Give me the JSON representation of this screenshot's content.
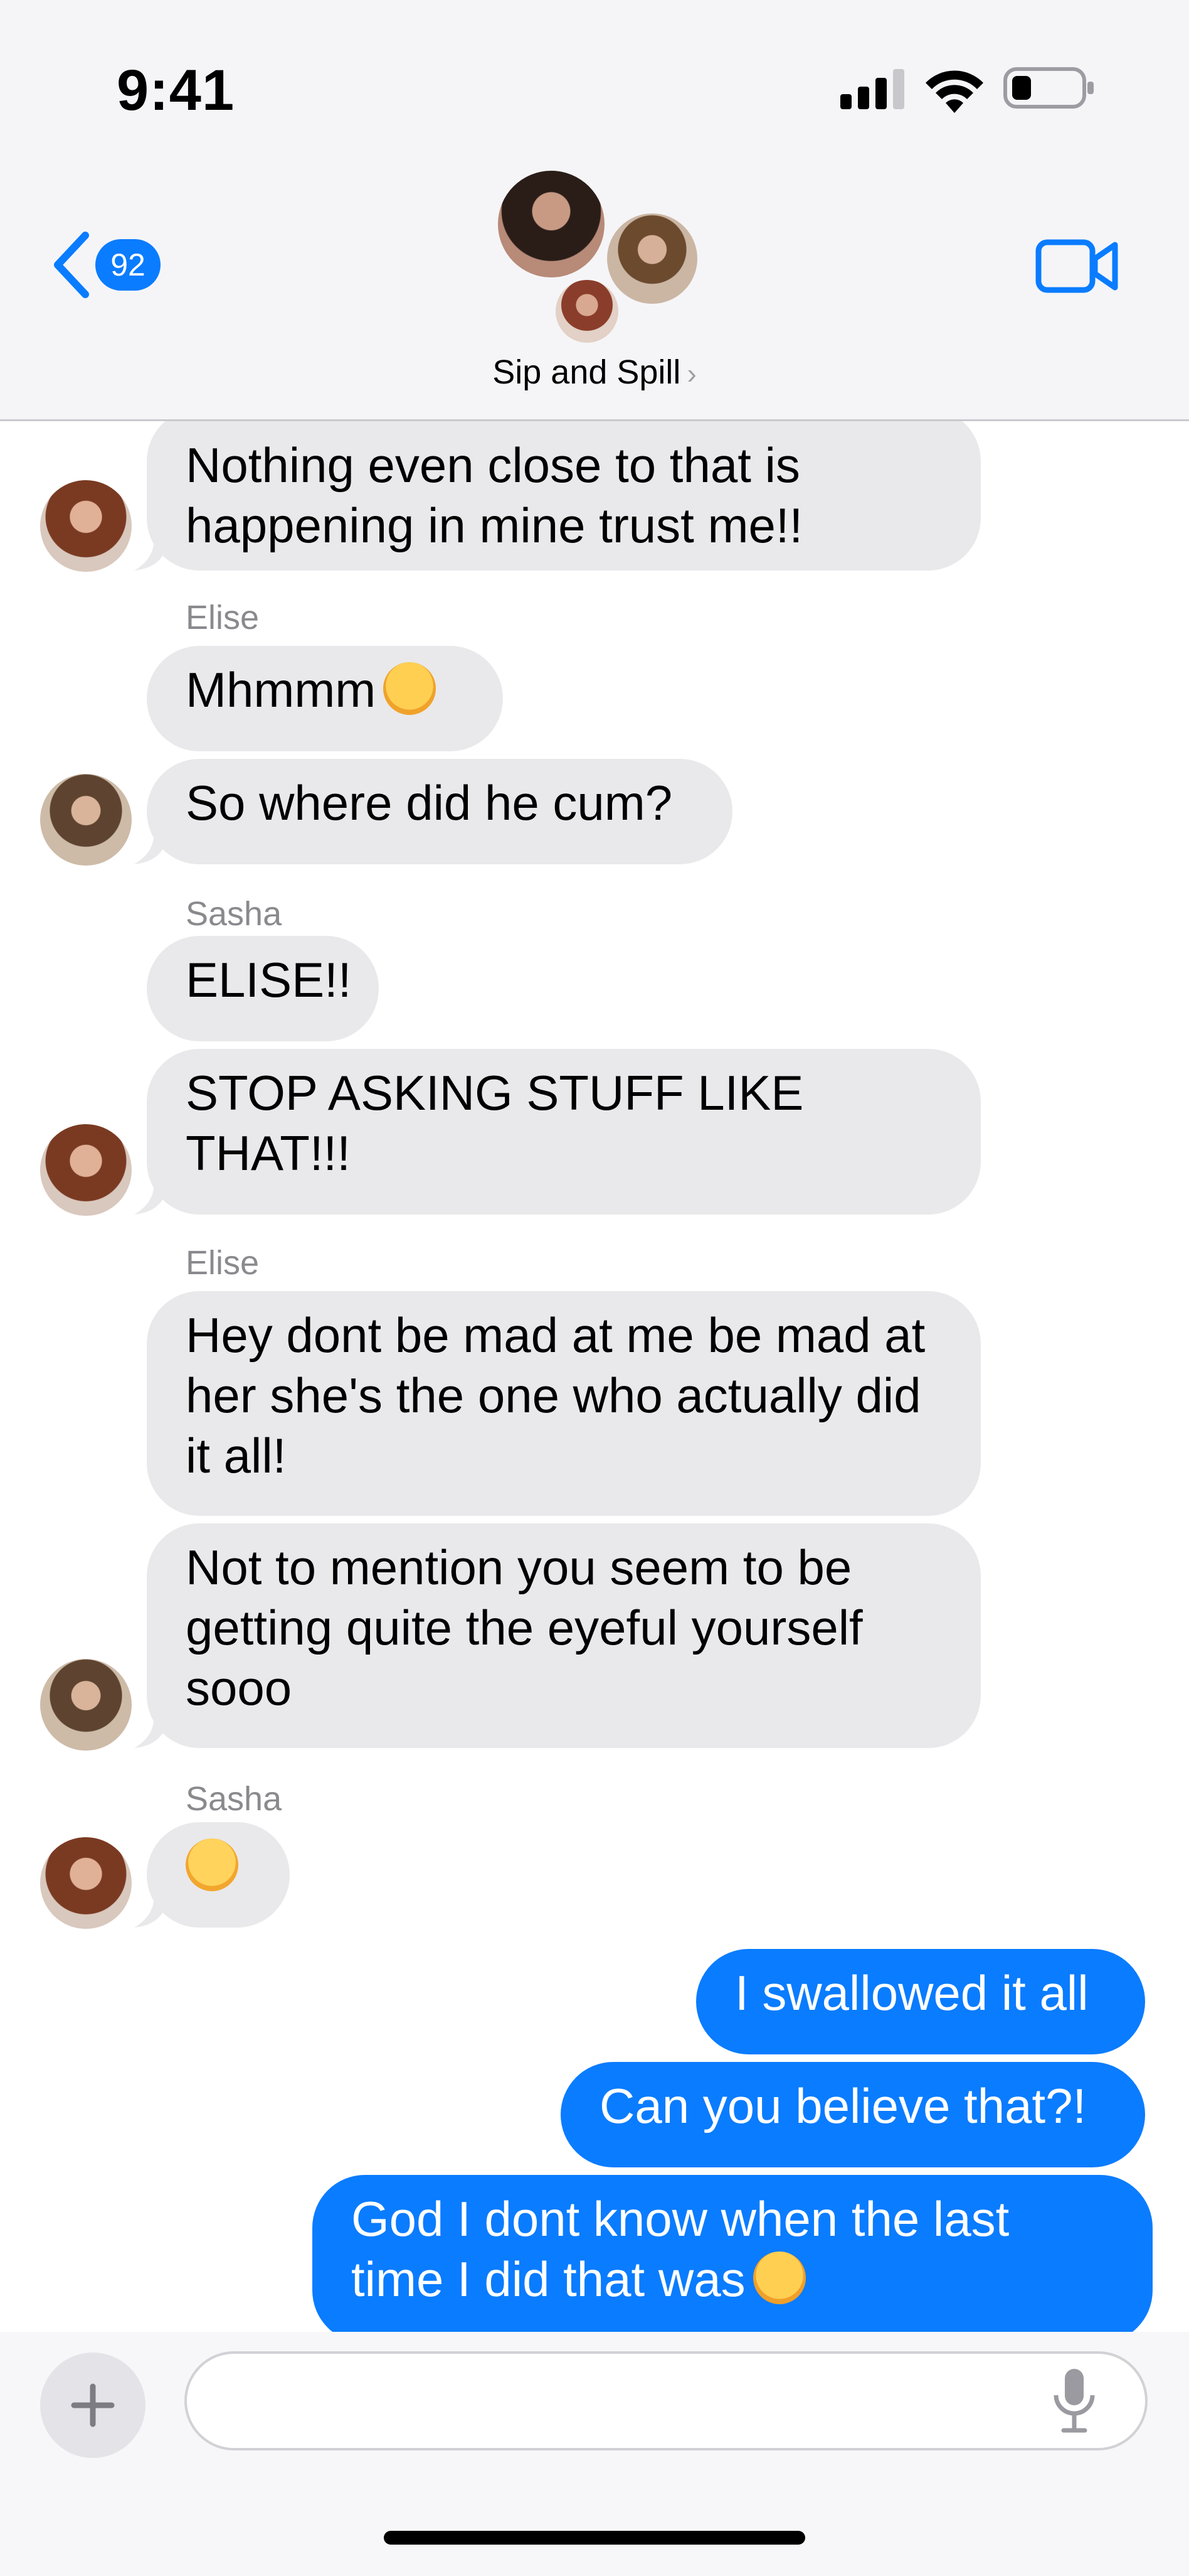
{
  "status_bar": {
    "time": "9:41"
  },
  "header": {
    "back_badge": "92",
    "group_name": "Sip and Spill",
    "chevron": "›",
    "icons": [
      "chevron-left-icon",
      "video-camera-icon"
    ]
  },
  "messages": [
    {
      "from": "Sasha",
      "direction": "in",
      "text": "Nothing even close to that is happening in mine trust me!!"
    },
    {
      "sender_label": "Elise"
    },
    {
      "from": "Elise",
      "direction": "in",
      "text": "Mhmmm",
      "emoji": "worried-face"
    },
    {
      "from": "Elise",
      "direction": "in",
      "text": "So where did he cum?"
    },
    {
      "sender_label": "Sasha"
    },
    {
      "from": "Sasha",
      "direction": "in",
      "text": "ELISE!!"
    },
    {
      "from": "Sasha",
      "direction": "in",
      "text": "STOP ASKING STUFF LIKE THAT!!!"
    },
    {
      "sender_label": "Elise"
    },
    {
      "from": "Elise",
      "direction": "in",
      "text": "Hey dont be mad at me be mad at her she's the one who actually did it all!"
    },
    {
      "from": "Elise",
      "direction": "in",
      "text": "Not to mention you seem to be getting quite the eyeful yourself sooo"
    },
    {
      "sender_label": "Sasha"
    },
    {
      "from": "Sasha",
      "direction": "in",
      "text": "",
      "emoji": "eye-roll-face"
    },
    {
      "from": "me",
      "direction": "out",
      "text": "I swallowed it all"
    },
    {
      "from": "me",
      "direction": "out",
      "text": "Can you believe that?!"
    },
    {
      "from": "me",
      "direction": "out",
      "text": "God I dont know when the last time I did that was",
      "emoji": "squinting-tongue-face"
    }
  ],
  "compose": {
    "icons": [
      "plus-icon",
      "microphone-icon"
    ],
    "input_placeholder": ""
  },
  "colors": {
    "accent": "#0a7cff",
    "incoming_bubble": "#e9e9eb",
    "header_bg": "#f5f5f7"
  }
}
